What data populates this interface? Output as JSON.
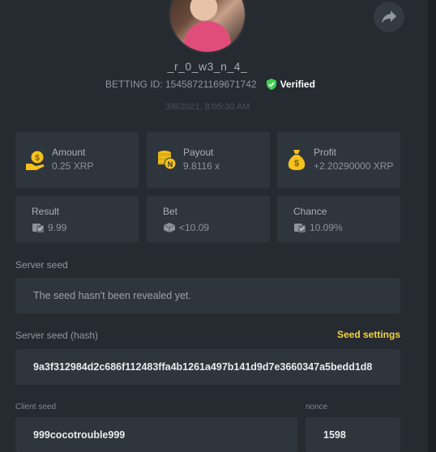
{
  "profile": {
    "username": "_r_0_w3_n_4_",
    "betting_id": "BETTING ID: 15458721169671742",
    "verified_label": "Verified",
    "date": "3/8/2021, 8:05:30 AM"
  },
  "stats": {
    "amount": {
      "label": "Amount",
      "value": "0.25 XRP"
    },
    "payout": {
      "label": "Payout",
      "value": "9.8116 x"
    },
    "profit": {
      "label": "Profit",
      "value": "+2.20290000 XRP"
    },
    "result": {
      "label": "Result",
      "value": "9.99"
    },
    "bet": {
      "label": "Bet",
      "value": "<10.09"
    },
    "chance": {
      "label": "Chance",
      "value": "10.09%"
    }
  },
  "server_seed": {
    "label": "Server seed",
    "value": "The seed hasn't been revealed yet."
  },
  "server_seed_hash": {
    "label": "Server seed (hash)",
    "settings_link": "Seed settings",
    "value": "9a3f312984d2c686f112483ffa4b1261a497b141d9d7e3660347a5bedd1d8"
  },
  "client_seed": {
    "label": "Client seed",
    "value": "999cocotrouble999"
  },
  "nonce": {
    "label": "nonce",
    "value": "1598"
  },
  "colors": {
    "background": "#262b32",
    "card": "#2f353d",
    "accent_yellow": "#f5d33c",
    "verified_green": "#3ccf4e"
  },
  "icons": [
    "share-icon",
    "verified-check-icon",
    "coin-hand-icon",
    "coin-stack-icon",
    "money-bag-icon",
    "dice-icon"
  ]
}
